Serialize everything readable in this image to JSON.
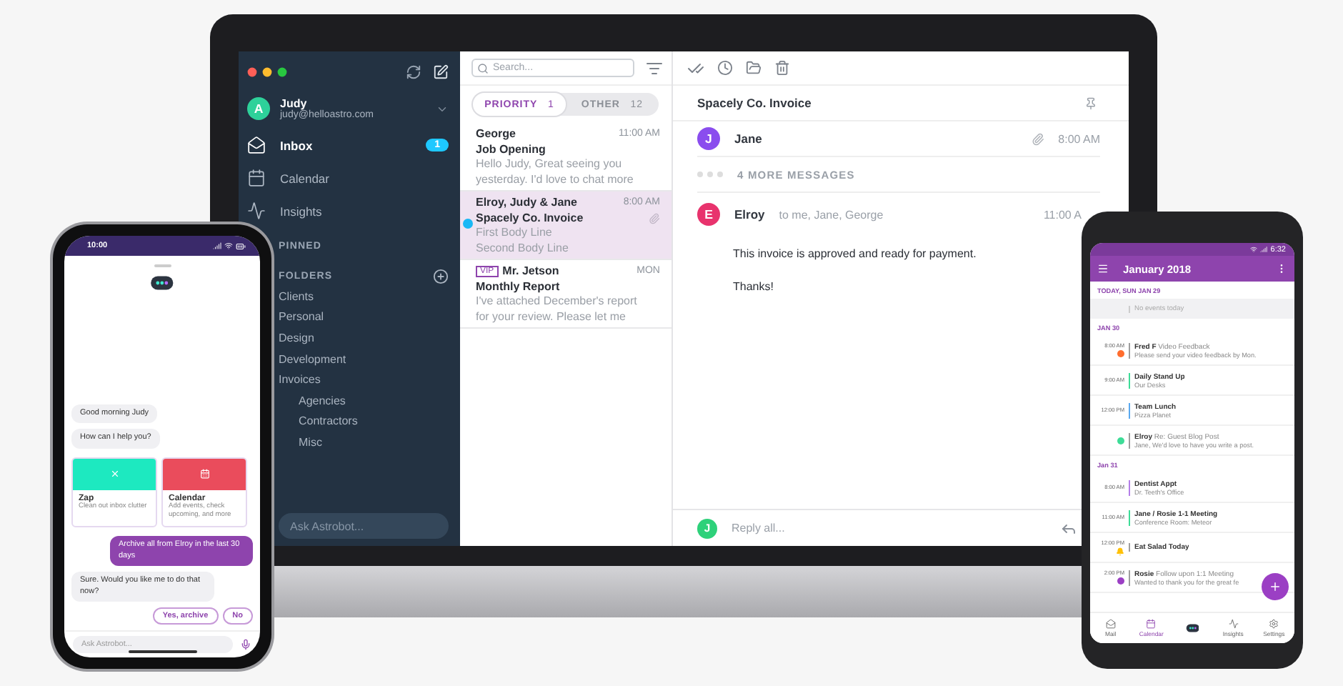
{
  "laptop": {
    "sidebar": {
      "avatar": "A",
      "name": "Judy",
      "email": "judy@helloastro.com",
      "nav": [
        {
          "kind": "inbox",
          "label": "Inbox",
          "badge": "1",
          "selected": true
        },
        {
          "kind": "calendar",
          "label": "Calendar",
          "selected": false
        },
        {
          "kind": "insights",
          "label": "Insights",
          "selected": false
        }
      ],
      "pinned_heading": "PINNED",
      "folders_heading": "FOLDERS",
      "folders": [
        {
          "label": "Clients"
        },
        {
          "label": "Personal"
        },
        {
          "label": "Design"
        },
        {
          "label": "Development"
        },
        {
          "label": "Invoices",
          "children": [
            {
              "label": "Agencies"
            },
            {
              "label": "Contractors"
            },
            {
              "label": "Misc"
            }
          ]
        }
      ],
      "assistant": {
        "placeholder": "Ask Astrobot..."
      }
    },
    "mail_list": {
      "search": {
        "placeholder": "Search..."
      },
      "tabs": [
        {
          "label": "PRIORITY",
          "count": "1",
          "selected": true
        },
        {
          "label": "OTHER",
          "count": "12",
          "selected": false
        }
      ],
      "messages": [
        {
          "sender": "George",
          "time": "11:00 AM",
          "subject": "Job Opening",
          "preview": [
            "Hello Judy, Great seeing you",
            "yesterday. I'd love to chat more"
          ],
          "selected": false,
          "unread": false,
          "attachment": false
        },
        {
          "sender": "Elroy, Judy & Jane",
          "time": "8:00 AM",
          "subject": "Spacely Co. Invoice",
          "preview": [
            "First Body Line",
            "Second Body Line"
          ],
          "selected": true,
          "unread": true,
          "attachment": true
        },
        {
          "tag": "VIP",
          "sender": "Mr. Jetson",
          "time": "MON",
          "subject": "Monthly Report",
          "preview": [
            "I've attached December's report",
            "for your review. Please let me"
          ],
          "selected": false,
          "unread": false,
          "attachment": false
        }
      ]
    },
    "thread": {
      "subject": "Spacely Co. Invoice",
      "messages": [
        {
          "kind": "header",
          "avatar": "J",
          "color": "#8a4dee",
          "sender": "Jane",
          "time": "8:00 AM",
          "attachment": true
        },
        {
          "kind": "more",
          "text": "4 MORE MESSAGES"
        },
        {
          "kind": "full",
          "avatar": "E",
          "color": "#e8336d",
          "sender": "Elroy",
          "recipients": "to me, Jane, George",
          "time": "11:00 A",
          "body": [
            "This invoice is approved and ready for payment.",
            "Thanks!"
          ]
        }
      ],
      "reply": {
        "avatar": "J",
        "placeholder": "Reply all..."
      }
    }
  },
  "chat_phone": {
    "time": "10:00",
    "items": [
      {
        "kind": "bot",
        "text": "Good morning Judy"
      },
      {
        "kind": "bot",
        "text": "How can I help you?"
      },
      {
        "kind": "cards",
        "cards": [
          {
            "title": "Zap",
            "text": "Clean out inbox clutter",
            "color": "#1de9c0"
          },
          {
            "title": "Calendar",
            "text": "Add events, check upcoming, and more",
            "color": "#ea4c5c"
          }
        ]
      },
      {
        "kind": "user",
        "text": "Archive all from Elroy in the last 30 days"
      },
      {
        "kind": "bot",
        "text": "Sure. Would you like me to do that now?"
      },
      {
        "kind": "choices",
        "options": [
          "Yes, archive",
          "No"
        ]
      }
    ],
    "input": {
      "placeholder": "Ask Astrobot..."
    }
  },
  "calendar_phone": {
    "time": "6:32",
    "title": "January 2018",
    "days": [
      {
        "label": "TODAY, SUN JAN 29",
        "empty": "No events today"
      },
      {
        "label": "JAN 30",
        "events": [
          {
            "time": "8:00 AM",
            "title": "Fred F",
            "title_note": "Video Feedback",
            "detail": "Please send your video feedback by Mon.",
            "color": "#9e9e9e",
            "badge": {
              "kind": "avatar",
              "color": "#ff6d2e"
            }
          },
          {
            "time": "9:00 AM",
            "title": "Daily Stand Up",
            "detail": "Our Desks",
            "color": "#3ddc97"
          },
          {
            "time": "12:00 PM",
            "title": "Team Lunch",
            "detail": "Pizza Planet",
            "color": "#5aa9f0"
          },
          {
            "title": "Elroy",
            "title_note": "Re: Guest Blog Post",
            "detail": "Jane, We'd love to have you write a post.",
            "color": "#9e9e9e",
            "badge": {
              "kind": "avatar",
              "color": "#3ddc97"
            }
          }
        ]
      },
      {
        "label": "Jan 31",
        "events": [
          {
            "time": "8:00 AM",
            "title": "Dentist Appt",
            "detail": "Dr. Teeth's Office",
            "color": "#b47ee8"
          },
          {
            "time": "11:00 AM",
            "title": "Jane / Rosie 1-1 Meeting",
            "detail": "Conference Room: Meteor",
            "color": "#3ddc97"
          },
          {
            "time": "12:00 PM",
            "title": "Eat Salad Today",
            "color": "#9e9e9e",
            "badge": {
              "kind": "bell",
              "color": "#ffc107"
            }
          },
          {
            "time": "2:00 PM",
            "title": "Rosie",
            "title_note": "Follow upon 1:1 Meeting",
            "detail": "Wanted to thank you for the great fe",
            "color": "#9e9e9e",
            "badge": {
              "kind": "avatar",
              "color": "#9b3fc4"
            }
          }
        ]
      }
    ],
    "tabs": [
      {
        "kind": "mail",
        "label": "Mail",
        "selected": false
      },
      {
        "kind": "calendar",
        "label": "Calendar",
        "selected": true
      },
      {
        "kind": "bot",
        "selected": false
      },
      {
        "kind": "insights",
        "label": "Insights",
        "selected": false
      },
      {
        "kind": "settings",
        "label": "Settings",
        "selected": false
      }
    ]
  }
}
